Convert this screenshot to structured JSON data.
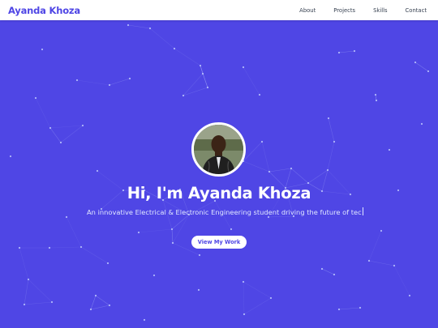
{
  "navbar": {
    "brand": "Ayanda Khoza",
    "links": [
      "About",
      "Projects",
      "Skills",
      "Contact"
    ]
  },
  "hero": {
    "headline": "Hi, I'm Ayanda Khoza",
    "tagline": "An innovative Electrical & Electronic Engineering student driving the future of tec",
    "cta_label": "View My Work",
    "avatar_alt": "profile photo"
  },
  "colors": {
    "brand": "#4f46e5",
    "hero_background": "#4f46e5",
    "particle": "#c7d2fe",
    "button_bg": "#ffffff",
    "button_text": "#4f46e5"
  },
  "icons": {
    "avatar": "user-avatar-icon"
  }
}
